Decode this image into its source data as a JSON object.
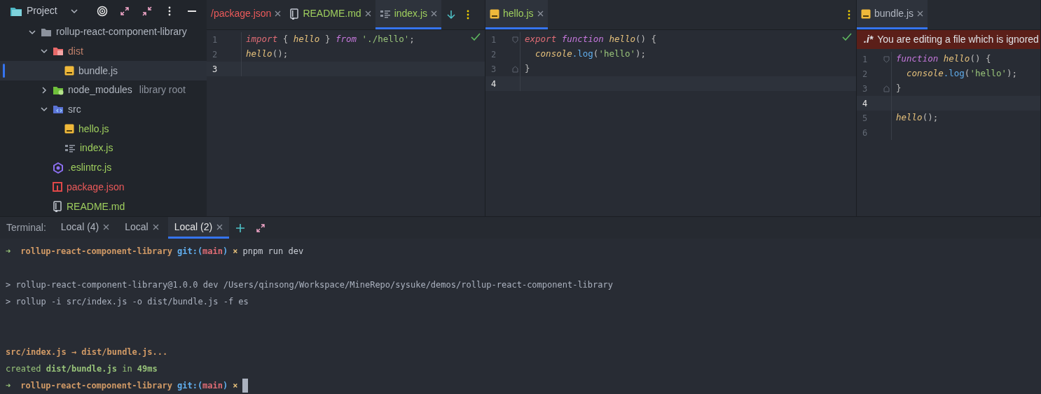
{
  "project_panel": {
    "title": "Project",
    "tree": [
      {
        "name": "rollup-react-component-library",
        "kind": "folder",
        "color": "#b0b6c0",
        "expanded": true,
        "selected": false,
        "children": [
          {
            "name": "dist",
            "kind": "folder-excluded",
            "color": "#c0806a",
            "expanded": true,
            "selected": false,
            "children": [
              {
                "name": "bundle.js",
                "kind": "js",
                "color": "#b0b6c0",
                "selected": true
              }
            ]
          },
          {
            "name": "node_modules",
            "suffix": "library root",
            "kind": "folder-module",
            "color": "#b0b6c0",
            "expanded": false,
            "selected": false
          },
          {
            "name": "src",
            "kind": "folder-source",
            "color": "#b0b6c0",
            "expanded": true,
            "selected": false,
            "children": [
              {
                "name": "hello.js",
                "kind": "js",
                "color": "#9fcf5e",
                "selected": false
              },
              {
                "name": "index.js",
                "kind": "structure",
                "color": "#9fcf5e",
                "selected": false
              }
            ]
          },
          {
            "name": ".eslintrc.js",
            "kind": "eslint",
            "color": "#9fcf5e",
            "selected": false
          },
          {
            "name": "package.json",
            "kind": "npm",
            "color": "#ec5a5a",
            "selected": false
          },
          {
            "name": "README.md",
            "kind": "book",
            "color": "#9fcf5e",
            "selected": false
          }
        ]
      }
    ]
  },
  "editor_panes": [
    {
      "tabs": [
        {
          "label": "/package.json",
          "kind": "none",
          "color": "#ec5a5a",
          "selected": false
        },
        {
          "label": "README.md",
          "kind": "book",
          "color": "#9fcf5e",
          "selected": false
        },
        {
          "label": "index.js",
          "kind": "structure",
          "color": "#9fcf5e",
          "selected": true
        }
      ],
      "actions": [
        {
          "kind": "download"
        },
        {
          "kind": "more"
        }
      ],
      "inspection_ok": true,
      "lines": [
        {
          "number": "1",
          "current": false,
          "kind": "plain",
          "tokens": [
            {
              "kind": "keyword",
              "text": "import"
            },
            {
              "kind": "punct",
              "text": " { "
            },
            {
              "kind": "func",
              "text": "hello"
            },
            {
              "kind": "punct",
              "text": " } "
            },
            {
              "kind": "keyword2",
              "text": "from"
            },
            {
              "kind": "string",
              "text": " './hello'"
            },
            {
              "kind": "punct",
              "text": ";"
            }
          ]
        },
        {
          "number": "2",
          "current": false,
          "kind": "plain",
          "tokens": [
            {
              "kind": "func",
              "text": "hello"
            },
            {
              "kind": "punct",
              "text": "();"
            }
          ]
        },
        {
          "number": "3",
          "current": true,
          "kind": "plain"
        }
      ]
    },
    {
      "tabs": [
        {
          "label": "hello.js",
          "kind": "js",
          "color": "#9fcf5e",
          "selected": true
        }
      ],
      "actions": [
        {
          "kind": "more"
        }
      ],
      "inspection_ok": true,
      "lines": [
        {
          "number": "1",
          "current": false,
          "kind": "fold-start",
          "tokens": [
            {
              "kind": "keyword",
              "text": "export"
            },
            {
              "kind": "keyword2",
              "text": " function"
            },
            {
              "kind": "func",
              "text": " hello"
            },
            {
              "kind": "punct",
              "text": "() {"
            }
          ]
        },
        {
          "number": "2",
          "current": false,
          "kind": "plain",
          "tokens": [
            {
              "kind": "func",
              "text": "  console"
            },
            {
              "kind": "method",
              "text": ".log"
            },
            {
              "kind": "punct",
              "text": "("
            },
            {
              "kind": "string",
              "text": "'hello'"
            },
            {
              "kind": "punct",
              "text": ");"
            }
          ]
        },
        {
          "number": "3",
          "current": false,
          "kind": "fold-end",
          "tokens": [
            {
              "kind": "punct",
              "text": "}"
            }
          ]
        },
        {
          "number": "4",
          "current": true,
          "kind": "plain"
        }
      ]
    },
    {
      "tabs": [
        {
          "label": "bundle.js",
          "kind": "js",
          "color": "#b0b6c0",
          "selected": true
        }
      ],
      "banner": {
        "tag": ".i*",
        "text": "You are editing a file which is ignored"
      },
      "lines": [
        {
          "number": "1",
          "current": false,
          "kind": "fold-start",
          "tokens": [
            {
              "kind": "keyword2",
              "text": "function"
            },
            {
              "kind": "func",
              "text": " hello"
            },
            {
              "kind": "punct",
              "text": "() {"
            }
          ]
        },
        {
          "number": "2",
          "current": false,
          "kind": "plain",
          "tokens": [
            {
              "kind": "func",
              "text": "  console"
            },
            {
              "kind": "method",
              "text": ".log"
            },
            {
              "kind": "punct",
              "text": "("
            },
            {
              "kind": "string",
              "text": "'hello'"
            },
            {
              "kind": "punct",
              "text": ");"
            }
          ]
        },
        {
          "number": "3",
          "current": false,
          "kind": "fold-end",
          "tokens": [
            {
              "kind": "punct",
              "text": "}"
            }
          ]
        },
        {
          "number": "4",
          "current": true,
          "kind": "plain"
        },
        {
          "number": "5",
          "current": false,
          "kind": "plain",
          "tokens": [
            {
              "kind": "func",
              "text": "hello"
            },
            {
              "kind": "punct",
              "text": "();"
            }
          ]
        },
        {
          "number": "6",
          "current": false,
          "kind": "plain"
        }
      ]
    }
  ],
  "terminal": {
    "label": "Terminal:",
    "tabs": [
      {
        "label": "Local (4)",
        "selected": false
      },
      {
        "label": "Local",
        "selected": false
      },
      {
        "label": "Local (2)",
        "selected": true
      }
    ],
    "lines": [
      {
        "kind": "prompt",
        "arrow": "➜",
        "dir": "rollup-react-component-library",
        "git": "git:(",
        "branch": "main",
        "git_end": ")",
        "dirty": "×",
        "command": "pnpm run dev"
      },
      {
        "kind": "blank"
      },
      {
        "kind": "output-plain",
        "text": "> rollup-react-component-library@1.0.0 dev /Users/qinsong/Workspace/MineRepo/sysuke/demos/rollup-react-component-library"
      },
      {
        "kind": "output-plain",
        "text": "> rollup -i src/index.js -o dist/bundle.js -f es"
      },
      {
        "kind": "blank"
      },
      {
        "kind": "blank"
      },
      {
        "kind": "output-orange",
        "text": "src/index.js → dist/bundle.js..."
      },
      {
        "kind": "output-green",
        "text": "created **dist/bundle.js** in **49ms**"
      },
      {
        "kind": "prompt",
        "arrow": "➜",
        "dir": "rollup-react-component-library",
        "git": "git:(",
        "branch": "main",
        "git_end": ")",
        "dirty": "×",
        "cursor": true
      }
    ]
  }
}
